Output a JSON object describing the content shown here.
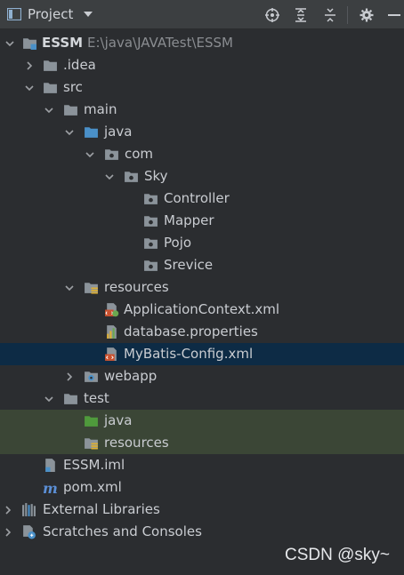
{
  "panel": {
    "title": "Project",
    "toolbar": {
      "locate_icon": "crosshair-icon",
      "expand_icon": "expand-all-icon",
      "collapse_icon": "collapse-all-icon",
      "settings_icon": "gear-icon",
      "hide_icon": "minus-icon"
    }
  },
  "tree": {
    "root": {
      "label": "ESSM",
      "path": "E:\\java\\JAVATest\\ESSM"
    },
    "idea": ".idea",
    "src": "src",
    "main": "main",
    "java": "java",
    "com": "com",
    "sky": "Sky",
    "controller": "Controller",
    "mapper": "Mapper",
    "pojo": "Pojo",
    "srevice": "Srevice",
    "resources": "resources",
    "appcontext": "ApplicationContext.xml",
    "dbprops": "database.properties",
    "mybatis": "MyBatis-Config.xml",
    "webapp": "webapp",
    "test": "test",
    "test_java": "java",
    "test_resources": "resources",
    "iml": "ESSM.iml",
    "pom": "pom.xml",
    "ext_libs": "External Libraries",
    "scratches": "Scratches and Consoles"
  },
  "colors": {
    "background": "#2b2d30",
    "header": "#3c3f41",
    "selected_row": "#0d2b45",
    "test_row": "#3b4636",
    "folder": "#8b939a",
    "source_folder": "#4a90c8",
    "test_folder": "#4f9a3c"
  },
  "watermark": "CSDN @sky~"
}
